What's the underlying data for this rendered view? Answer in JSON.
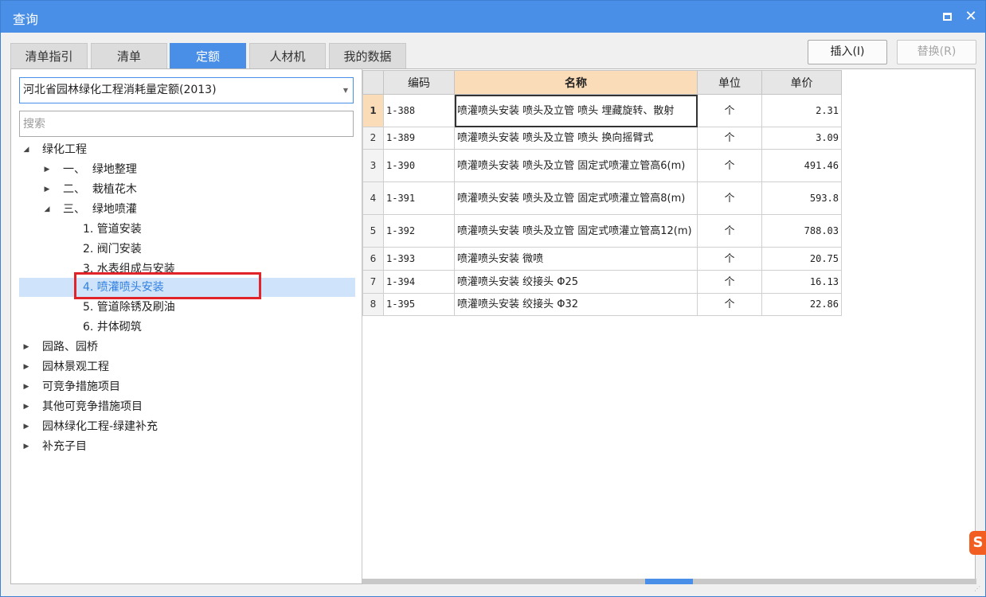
{
  "window": {
    "title": "查询"
  },
  "tabs": [
    {
      "label": "清单指引",
      "active": false
    },
    {
      "label": "清单",
      "active": false
    },
    {
      "label": "定额",
      "active": true
    },
    {
      "label": "人材机",
      "active": false
    },
    {
      "label": "我的数据",
      "active": false
    }
  ],
  "buttons": {
    "insert": "插入(I)",
    "replace": "替换(R)"
  },
  "library": {
    "selected": "河北省园林绿化工程消耗量定额(2013)"
  },
  "search": {
    "placeholder": "搜索"
  },
  "tree": [
    {
      "label": "绿化工程",
      "state": "expanded"
    },
    {
      "label": "一、  绿地整理",
      "state": "collapsed"
    },
    {
      "label": "二、  栽植花木",
      "state": "collapsed"
    },
    {
      "label": "三、  绿地喷灌",
      "state": "expanded"
    },
    {
      "label": "1. 管道安装",
      "state": "leaf"
    },
    {
      "label": "2. 阀门安装",
      "state": "leaf"
    },
    {
      "label": "3. 水表组成与安装",
      "state": "leaf"
    },
    {
      "label": "4. 喷灌喷头安装",
      "state": "leaf",
      "selected": true
    },
    {
      "label": "5. 管道除锈及刷油",
      "state": "leaf"
    },
    {
      "label": "6. 井体砌筑",
      "state": "leaf"
    },
    {
      "label": "园路、园桥",
      "state": "collapsed"
    },
    {
      "label": "园林景观工程",
      "state": "collapsed"
    },
    {
      "label": "可竞争措施项目",
      "state": "collapsed"
    },
    {
      "label": "其他可竞争措施项目",
      "state": "collapsed"
    },
    {
      "label": "园林绿化工程-绿建补充",
      "state": "collapsed"
    },
    {
      "label": "补充子目",
      "state": "collapsed"
    }
  ],
  "table": {
    "headers": [
      "编码",
      "名称",
      "单位",
      "单价"
    ],
    "rows": [
      {
        "no": "1",
        "code": "1-388",
        "name": "喷灌喷头安装 喷头及立管 喷头 埋藏旋转、散射",
        "unit": "个",
        "price": "2.31"
      },
      {
        "no": "2",
        "code": "1-389",
        "name": "喷灌喷头安装 喷头及立管 喷头 换向摇臂式",
        "unit": "个",
        "price": "3.09"
      },
      {
        "no": "3",
        "code": "1-390",
        "name": "喷灌喷头安装 喷头及立管 固定式喷灌立管高6(m)",
        "unit": "个",
        "price": "491.46"
      },
      {
        "no": "4",
        "code": "1-391",
        "name": "喷灌喷头安装 喷头及立管 固定式喷灌立管高8(m)",
        "unit": "个",
        "price": "593.8"
      },
      {
        "no": "5",
        "code": "1-392",
        "name": "喷灌喷头安装 喷头及立管 固定式喷灌立管高12(m)",
        "unit": "个",
        "price": "788.03"
      },
      {
        "no": "6",
        "code": "1-393",
        "name": "喷灌喷头安装 微喷",
        "unit": "个",
        "price": "20.75"
      },
      {
        "no": "7",
        "code": "1-394",
        "name": "喷灌喷头安装 绞接头 Φ25",
        "unit": "个",
        "price": "16.13"
      },
      {
        "no": "8",
        "code": "1-395",
        "name": "喷灌喷头安装 绞接头 Φ32",
        "unit": "个",
        "price": "22.86"
      }
    ]
  }
}
